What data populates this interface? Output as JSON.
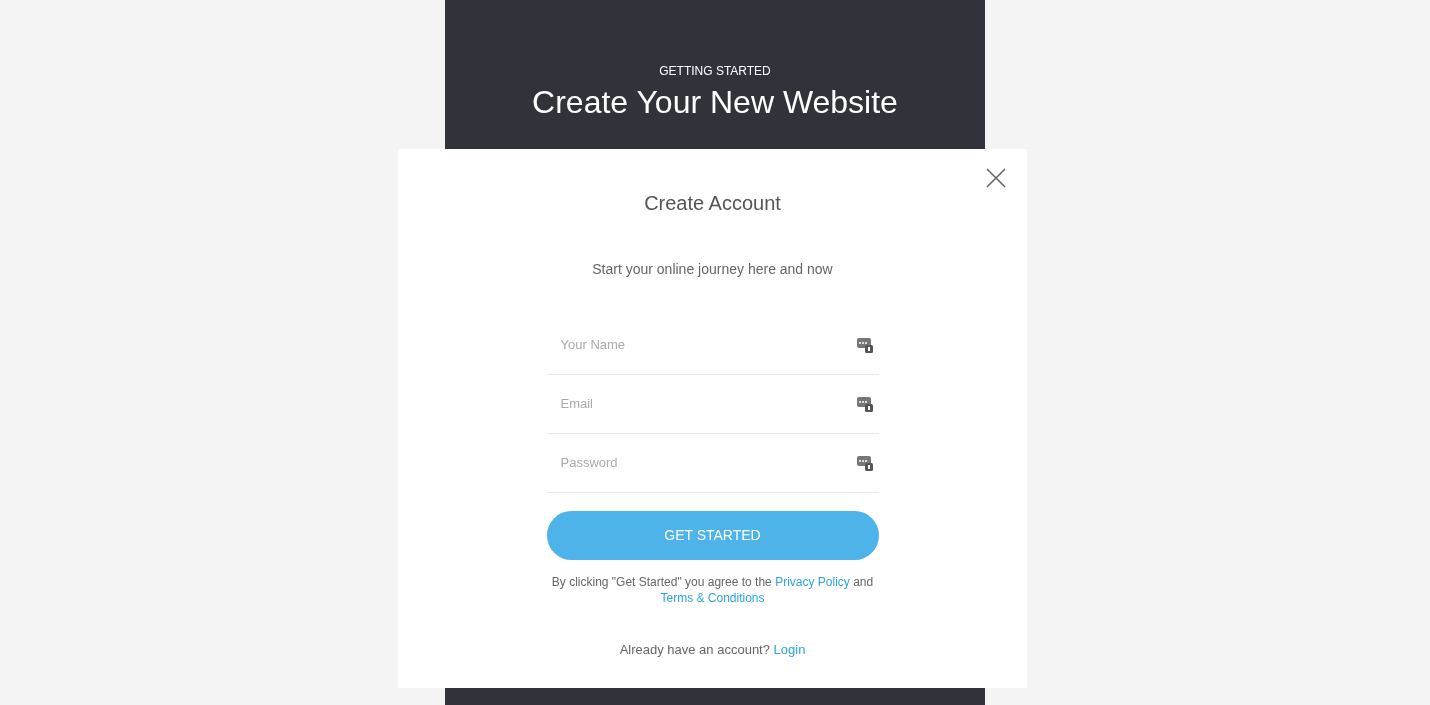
{
  "header": {
    "eyebrow": "GETTING STARTED",
    "title": "Create Your New Website"
  },
  "modal": {
    "title": "Create Account",
    "subtitle": "Start your online journey here and now",
    "fields": [
      {
        "placeholder": "Your Name"
      },
      {
        "placeholder": "Email"
      },
      {
        "placeholder": "Password"
      }
    ],
    "submit": "GET STARTED",
    "agreement": {
      "before": "By clicking \"Get Started\" you agree to the",
      "link_1": "Privacy Policy",
      "middle": "and",
      "link_2": "Terms & Conditions"
    },
    "login": {
      "text": "Already have an account?",
      "link": "Login"
    }
  }
}
